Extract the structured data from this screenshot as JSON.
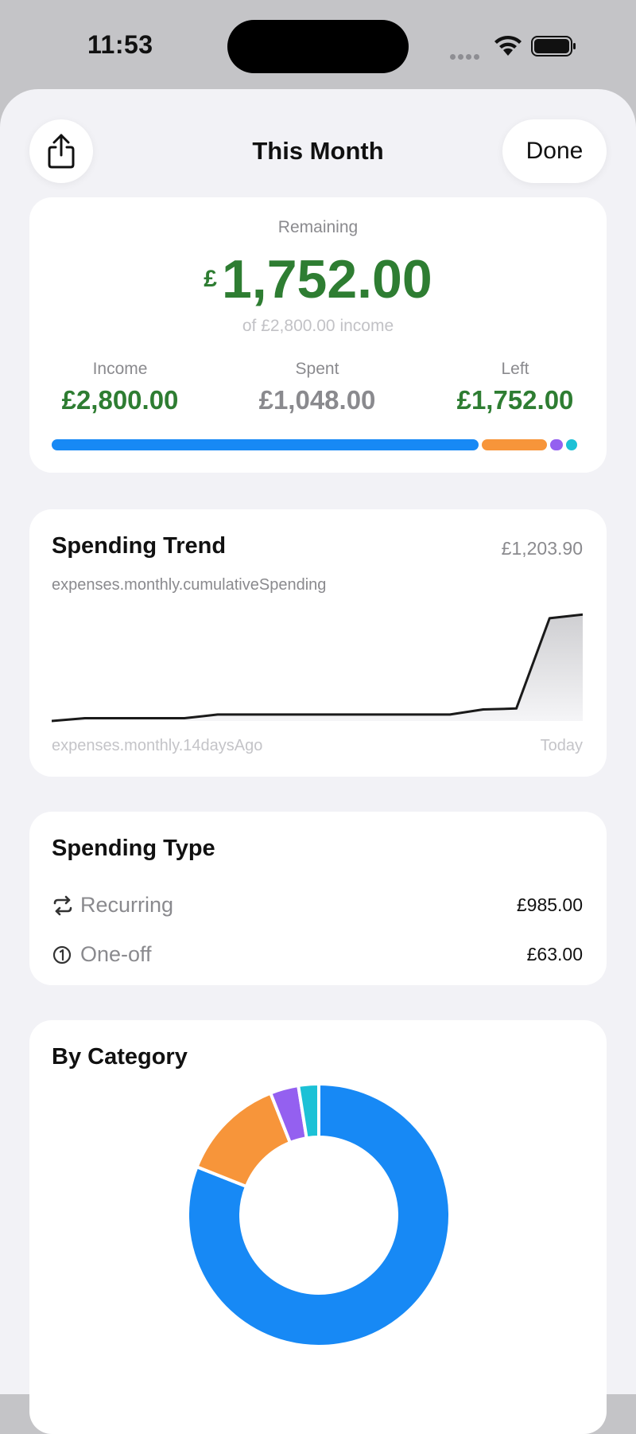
{
  "status_bar": {
    "time": "11:53"
  },
  "header": {
    "title": "This Month",
    "done_label": "Done"
  },
  "summary": {
    "remaining_label": "Remaining",
    "currency_symbol": "£",
    "remaining_amount": "1,752.00",
    "of_income": "of £2,800.00 income",
    "income_label": "Income",
    "income_value": "£2,800.00",
    "spent_label": "Spent",
    "spent_value": "£1,048.00",
    "left_label": "Left",
    "left_value": "£1,752.00",
    "budget_bar": [
      {
        "name": "blue",
        "color": "#1789f5",
        "fraction": 0.81
      },
      {
        "name": "orange",
        "color": "#f7953a",
        "fraction": 0.128
      },
      {
        "name": "purple",
        "color": "#9460f0",
        "fraction": 0.03
      },
      {
        "name": "teal",
        "color": "#1cc1d6",
        "fraction": 0.022
      }
    ]
  },
  "spending_trend": {
    "title": "Spending Trend",
    "total": "£1,203.90",
    "subtitle": "expenses.monthly.cumulativeSpending",
    "axis_start": "expenses.monthly.14daysAgo",
    "axis_end": "Today"
  },
  "spending_type": {
    "title": "Spending Type",
    "rows": [
      {
        "label": "Recurring",
        "value": "£985.00",
        "icon": "repeat-icon"
      },
      {
        "label": "One-off",
        "value": "£63.00",
        "icon": "one-circle-icon"
      }
    ]
  },
  "by_category": {
    "title": "By Category"
  },
  "colors": {
    "positive": "#2e7d32",
    "blue": "#1789f5",
    "orange": "#f7953a",
    "purple": "#9460f0",
    "teal": "#1cc1d6"
  },
  "chart_data": [
    {
      "type": "area",
      "title": "Spending Trend",
      "x": [
        1,
        2,
        3,
        4,
        5,
        6,
        7,
        8,
        9,
        10,
        11,
        12,
        13,
        14,
        15
      ],
      "values": [
        0,
        30,
        30,
        30,
        30,
        70,
        70,
        70,
        70,
        70,
        70,
        70,
        70,
        125,
        135,
        1110,
        1150
      ],
      "ylim": [
        0,
        1204
      ]
    },
    {
      "type": "pie",
      "title": "By Category",
      "series": [
        {
          "name": "blue",
          "value": 0.81,
          "color": "#1789f5"
        },
        {
          "name": "orange",
          "value": 0.13,
          "color": "#f7953a"
        },
        {
          "name": "purple",
          "value": 0.035,
          "color": "#9460f0"
        },
        {
          "name": "teal",
          "value": 0.025,
          "color": "#1cc1d6"
        }
      ]
    }
  ]
}
